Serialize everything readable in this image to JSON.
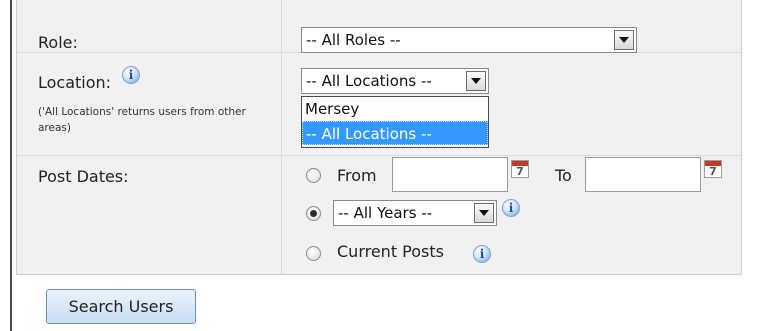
{
  "form": {
    "role": {
      "label": "Role:",
      "selected": "-- All Roles --"
    },
    "location": {
      "label": "Location:",
      "note": "('All Locations' returns users from other areas)",
      "selected": "-- All Locations --",
      "options": [
        "Mersey",
        "-- All Locations --"
      ]
    },
    "post_dates": {
      "label": "Post Dates:",
      "from_label": "From",
      "to_label": "To",
      "from_value": "",
      "to_value": "",
      "years_selected": "-- All Years --",
      "current_posts_label": "Current Posts",
      "selected_option": "years"
    }
  },
  "actions": {
    "search_label": "Search Users"
  },
  "icons": {
    "info": "info-icon",
    "calendar": "calendar-icon",
    "calendar_glyph": "7"
  },
  "colors": {
    "highlight": "#3399ff",
    "button_border": "#6f8fb6"
  }
}
